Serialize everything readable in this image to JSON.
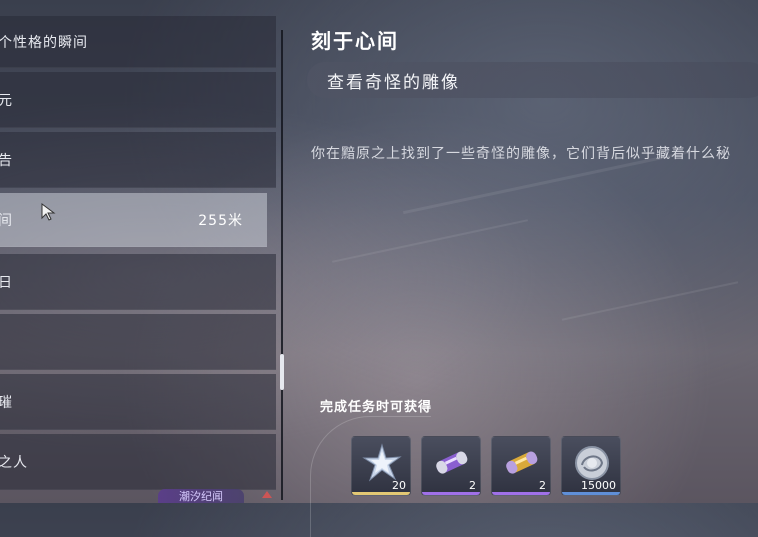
{
  "quest_list": {
    "items": [
      {
        "label": "个性格的瞬间"
      },
      {
        "label": "元"
      },
      {
        "label": "告"
      },
      {
        "label": "间",
        "distance": "255米",
        "active": true
      },
      {
        "label": "日"
      },
      {
        "label": ""
      },
      {
        "label": "璀"
      },
      {
        "label": "之人"
      }
    ],
    "bottom_tab": "潮汐纪闻"
  },
  "quest": {
    "title": "刻于心间",
    "subtitle": "查看奇怪的雕像",
    "description": "你在黯原之上找到了一些奇怪的雕像，它们背后似乎藏着什么秘"
  },
  "rewards": {
    "heading": "完成任务时可获得",
    "items": [
      {
        "icon": "crystal-star-icon",
        "count": "20",
        "rarity_color": "#e3c874"
      },
      {
        "icon": "purple-capsule-icon",
        "count": "2",
        "rarity_color": "#a070e8"
      },
      {
        "icon": "gold-capsule-icon",
        "count": "2",
        "rarity_color": "#a070e8"
      },
      {
        "icon": "shell-coin-icon",
        "count": "15000",
        "rarity_color": "#5f8fd8"
      }
    ]
  }
}
